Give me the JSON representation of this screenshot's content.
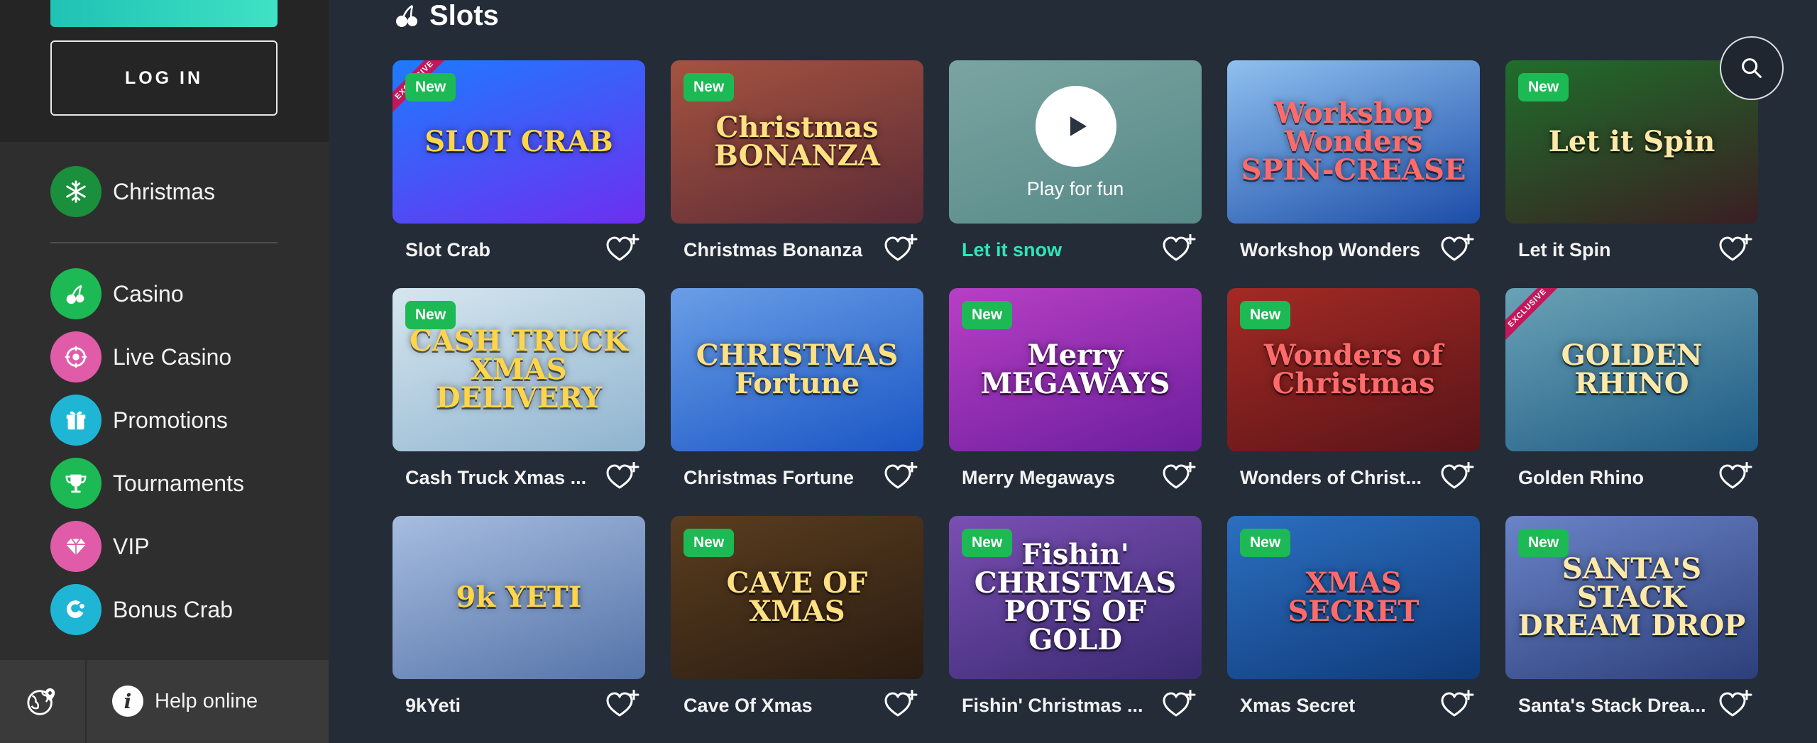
{
  "sidebar": {
    "login_label": "LOG IN",
    "featured": {
      "label": "Christmas",
      "icon": "snowflake-icon",
      "color": "#1db954"
    },
    "items": [
      {
        "label": "Casino",
        "icon": "cherries-icon",
        "color": "#1db954"
      },
      {
        "label": "Live Casino",
        "icon": "roulette-icon",
        "color": "#e05ca8"
      },
      {
        "label": "Promotions",
        "icon": "gift-icon",
        "color": "#1fb6d6"
      },
      {
        "label": "Tournaments",
        "icon": "trophy-icon",
        "color": "#1db954"
      },
      {
        "label": "VIP",
        "icon": "diamond-icon",
        "color": "#e05ca8"
      },
      {
        "label": "Bonus Crab",
        "icon": "bonus-crab-icon",
        "color": "#1fb6d6"
      }
    ],
    "help_label": "Help online"
  },
  "main": {
    "section_title": "Slots",
    "play_label": "Play for fun",
    "new_label": "New",
    "exclusive_label": "EXCLUSIVE",
    "games": [
      {
        "name": "Slot Crab",
        "art": "SLOT CRAB",
        "badge": "New",
        "exclusive": true,
        "colors": [
          "#6d2ff0",
          "#1e7bff"
        ]
      },
      {
        "name": "Christmas Bonanza",
        "art": "Christmas BONANZA",
        "badge": "New",
        "exclusive": false,
        "colors": [
          "#5b2b36",
          "#a5533f"
        ]
      },
      {
        "name": "Let it snow",
        "art": "",
        "badge": "",
        "exclusive": false,
        "colors": [
          "#3c7c77",
          "#8ab6b0"
        ],
        "active": true
      },
      {
        "name": "Workshop Wonders",
        "art": "Workshop Wonders SPIN-CREASE",
        "badge": "",
        "exclusive": false,
        "colors": [
          "#1c4da8",
          "#8fc0ef"
        ]
      },
      {
        "name": "Let it Spin",
        "art": "Let it Spin",
        "badge": "New",
        "exclusive": false,
        "colors": [
          "#3a1e22",
          "#1f6e2b"
        ]
      },
      {
        "name": "Cash Truck Xmas ...",
        "art": "CASH TRUCK XMAS DELIVERY",
        "badge": "New",
        "exclusive": false,
        "colors": [
          "#8fb4cf",
          "#d6e6ef"
        ]
      },
      {
        "name": "Christmas Fortune",
        "art": "CHRISTMAS Fortune",
        "badge": "",
        "exclusive": false,
        "colors": [
          "#1a56c5",
          "#6a9ee6"
        ]
      },
      {
        "name": "Merry Megaways",
        "art": "Merry MEGAWAYS",
        "badge": "New",
        "exclusive": false,
        "colors": [
          "#6b1e9d",
          "#b83fc5"
        ]
      },
      {
        "name": "Wonders of Christ...",
        "art": "Wonders of Christmas",
        "badge": "New",
        "exclusive": false,
        "colors": [
          "#5a1418",
          "#a32a24"
        ]
      },
      {
        "name": "Golden Rhino",
        "art": "GOLDEN RHINO",
        "badge": "",
        "exclusive": true,
        "colors": [
          "#1e5b85",
          "#6aa2b5"
        ]
      },
      {
        "name": "9kYeti",
        "art": "9k YETI",
        "badge": "",
        "exclusive": false,
        "colors": [
          "#5473a8",
          "#a7bde0"
        ]
      },
      {
        "name": "Cave Of Xmas",
        "art": "CAVE OF XMAS",
        "badge": "New",
        "exclusive": false,
        "colors": [
          "#2a1c12",
          "#5a3d1e"
        ]
      },
      {
        "name": "Fishin' Christmas ...",
        "art": "Fishin' CHRISTMAS POTS OF GOLD",
        "badge": "New",
        "exclusive": false,
        "colors": [
          "#3a2a72",
          "#7a4fb2"
        ]
      },
      {
        "name": "Xmas Secret",
        "art": "XMAS SECRET",
        "badge": "New",
        "exclusive": false,
        "colors": [
          "#0f3a7a",
          "#2c6fc0"
        ]
      },
      {
        "name": "Santa's Stack Drea...",
        "art": "SANTA'S STACK DREAM DROP",
        "badge": "New",
        "exclusive": false,
        "colors": [
          "#2d3f7a",
          "#6a84c8"
        ]
      }
    ]
  }
}
